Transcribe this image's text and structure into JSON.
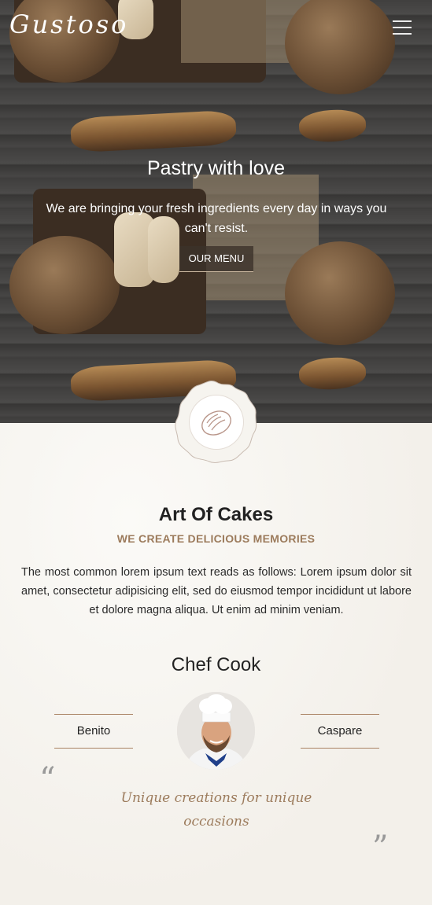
{
  "header": {
    "logo": "Gustoso",
    "menu_icon": "hamburger-icon"
  },
  "hero": {
    "title": "Pastry with love",
    "subtitle": "We are bringing your fresh ingredients every day in ways you can't resist.",
    "cta_label": "OUR MENU"
  },
  "badge": {
    "icon": "bread-icon"
  },
  "about": {
    "title": "Art Of Cakes",
    "tagline": "WE CREATE DELICIOUS MEMORIES",
    "body": "The most common lorem ipsum text reads as follows: Lorem ipsum dolor sit amet, consectetur adipisicing elit, sed do eiusmod tempor incididunt ut labore et dolore magna aliqua. Ut enim ad minim veniam."
  },
  "chefs": {
    "title": "Chef Cook",
    "left_name": "Benito",
    "right_name": "Caspare"
  },
  "quote": {
    "open_mark": "“",
    "close_mark": "”",
    "text": "Unique creations for unique occasions"
  },
  "colors": {
    "accent": "#9c7b5c",
    "text": "#222222",
    "background": "#f6f4ef"
  }
}
